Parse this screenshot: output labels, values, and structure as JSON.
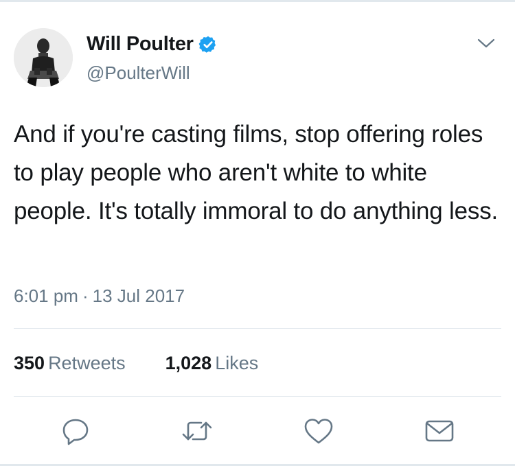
{
  "tweet": {
    "author": {
      "display_name": "Will Poulter",
      "handle": "@PoulterWill",
      "verified": true,
      "verified_color": "#1da1f2"
    },
    "text": "And if you're casting films, stop offering roles to play people who aren't white to white people. It's totally immoral to do anything less.",
    "time": "6:01 pm",
    "separator": "·",
    "date": "13 Jul 2017"
  },
  "stats": {
    "retweets_count": "350",
    "retweets_label": "Retweets",
    "likes_count": "1,028",
    "likes_label": "Likes"
  },
  "actions": {
    "icons": [
      "reply-icon",
      "retweet-icon",
      "like-icon",
      "share-dm-icon"
    ],
    "icon_color": "#657786"
  },
  "menu": {
    "icon": "chevron-down-icon"
  }
}
